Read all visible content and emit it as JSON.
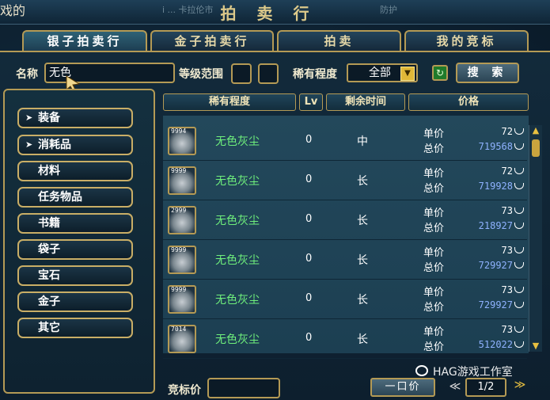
{
  "window": {
    "title": "拍卖行",
    "ghost_left": "i ... 卡拉伦市",
    "ghost_right": "防护",
    "ghost_edge": "戏的"
  },
  "tabs": [
    "银子拍卖行",
    "金子拍卖行",
    "拍卖",
    "我的竞标"
  ],
  "search": {
    "name_label": "名称",
    "name_value": "无色",
    "level_label": "等级范围",
    "rarity_label": "稀有程度",
    "rarity_selected": "全部",
    "refresh_icon": "refresh-icon",
    "search_label": "搜 索"
  },
  "categories": [
    {
      "label": "装备",
      "expandable": true
    },
    {
      "label": "消耗品",
      "expandable": true
    },
    {
      "label": "材料",
      "expandable": false
    },
    {
      "label": "任务物品",
      "expandable": false
    },
    {
      "label": "书籍",
      "expandable": false
    },
    {
      "label": "袋子",
      "expandable": false
    },
    {
      "label": "宝石",
      "expandable": false
    },
    {
      "label": "金子",
      "expandable": false
    },
    {
      "label": "其它",
      "expandable": false
    }
  ],
  "columns": [
    "稀有程度",
    "Lv",
    "剩余时间",
    "价格"
  ],
  "unit_label": "单价",
  "total_label": "总价",
  "listings": [
    {
      "qty": "9994",
      "name": "无色灰尘",
      "lv": "0",
      "time": "中",
      "unit": "72",
      "total": "719568"
    },
    {
      "qty": "9999",
      "name": "无色灰尘",
      "lv": "0",
      "time": "长",
      "unit": "72",
      "total": "719928"
    },
    {
      "qty": "2999",
      "name": "无色灰尘",
      "lv": "0",
      "time": "长",
      "unit": "73",
      "total": "218927"
    },
    {
      "qty": "9999",
      "name": "无色灰尘",
      "lv": "0",
      "time": "长",
      "unit": "73",
      "total": "729927"
    },
    {
      "qty": "9999",
      "name": "无色灰尘",
      "lv": "0",
      "time": "长",
      "unit": "73",
      "total": "729927"
    },
    {
      "qty": "7014",
      "name": "无色灰尘",
      "lv": "0",
      "time": "长",
      "unit": "73",
      "total": "512022"
    }
  ],
  "colors": {
    "gold_border": "#b49a55",
    "item_name": "#6ff07c",
    "total_price": "#8fb2ff",
    "unit_price": "#ffffff"
  },
  "footer": {
    "bid_label": "竞标价",
    "buyout_label": "一口价",
    "page": "1/2",
    "watermark": "HAG游戏工作室"
  }
}
